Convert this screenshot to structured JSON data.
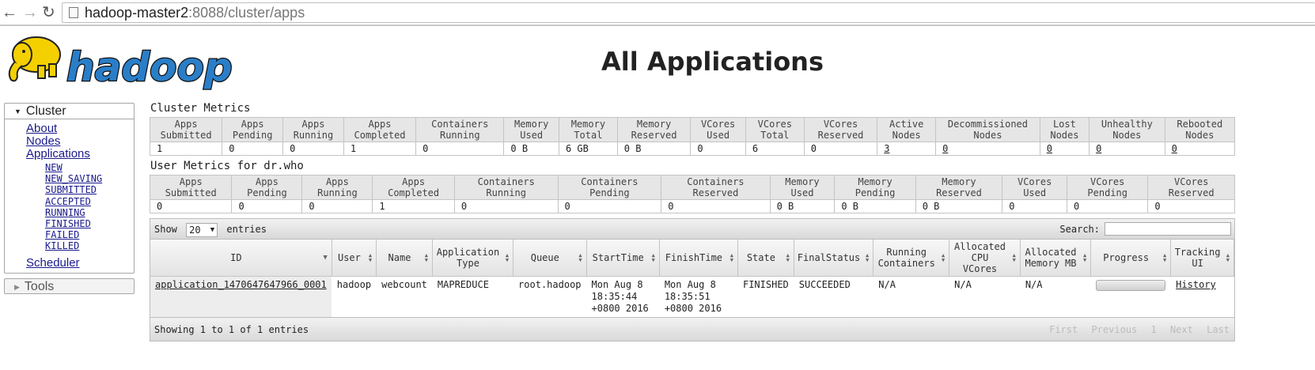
{
  "browser": {
    "url_host": "hadoop-master2",
    "url_rest": ":8088/cluster/apps"
  },
  "page": {
    "title": "All Applications"
  },
  "logo": {
    "text": "hadoop"
  },
  "sidebar": {
    "cluster_label": "Cluster",
    "links": [
      "About",
      "Nodes",
      "Applications"
    ],
    "app_states": [
      "NEW",
      "NEW_SAVING",
      "SUBMITTED",
      "ACCEPTED",
      "RUNNING",
      "FINISHED",
      "FAILED",
      "KILLED"
    ],
    "scheduler_label": "Scheduler",
    "tools_label": "Tools"
  },
  "cluster_metrics": {
    "title": "Cluster Metrics",
    "headers": [
      "Apps Submitted",
      "Apps Pending",
      "Apps Running",
      "Apps Completed",
      "Containers Running",
      "Memory Used",
      "Memory Total",
      "Memory Reserved",
      "VCores Used",
      "VCores Total",
      "VCores Reserved",
      "Active Nodes",
      "Decommissioned Nodes",
      "Lost Nodes",
      "Unhealthy Nodes",
      "Rebooted Nodes"
    ],
    "values": [
      "1",
      "0",
      "0",
      "1",
      "0",
      "0 B",
      "6 GB",
      "0 B",
      "0",
      "6",
      "0",
      "3",
      "0",
      "0",
      "0",
      "0"
    ],
    "linked": [
      false,
      false,
      false,
      false,
      false,
      false,
      false,
      false,
      false,
      false,
      false,
      true,
      true,
      true,
      true,
      true
    ]
  },
  "user_metrics": {
    "title": "User Metrics for dr.who",
    "headers": [
      "Apps Submitted",
      "Apps Pending",
      "Apps Running",
      "Apps Completed",
      "Containers Running",
      "Containers Pending",
      "Containers Reserved",
      "Memory Used",
      "Memory Pending",
      "Memory Reserved",
      "VCores Used",
      "VCores Pending",
      "VCores Reserved"
    ],
    "values": [
      "0",
      "0",
      "0",
      "1",
      "0",
      "0",
      "0",
      "0 B",
      "0 B",
      "0 B",
      "0",
      "0",
      "0"
    ]
  },
  "apps_table": {
    "show_label": "Show",
    "page_size": "20",
    "entries_label": "entries",
    "search_label": "Search:",
    "columns": [
      "ID",
      "User",
      "Name",
      "Application Type",
      "Queue",
      "StartTime",
      "FinishTime",
      "State",
      "FinalStatus",
      "Running Containers",
      "Allocated CPU VCores",
      "Allocated Memory MB",
      "Progress",
      "Tracking UI"
    ],
    "rows": [
      {
        "id": "application_1470647647966_0001",
        "user": "hadoop",
        "name": "webcount",
        "type": "MAPREDUCE",
        "queue": "root.hadoop",
        "start": "Mon Aug 8 18:35:44 +0800 2016",
        "finish": "Mon Aug 8 18:35:51 +0800 2016",
        "state": "FINISHED",
        "final_status": "SUCCEEDED",
        "running_containers": "N/A",
        "alloc_cpu": "N/A",
        "alloc_mem": "N/A",
        "progress": 0,
        "tracking": "History"
      }
    ],
    "footer_info": "Showing 1 to 1 of 1 entries",
    "pager": {
      "first": "First",
      "previous": "Previous",
      "page": "1",
      "next": "Next",
      "last": "Last"
    }
  },
  "colors": {
    "link": "#1a1a8c",
    "logo_blue": "#2a7ec8",
    "logo_yellow": "#f5d000"
  }
}
